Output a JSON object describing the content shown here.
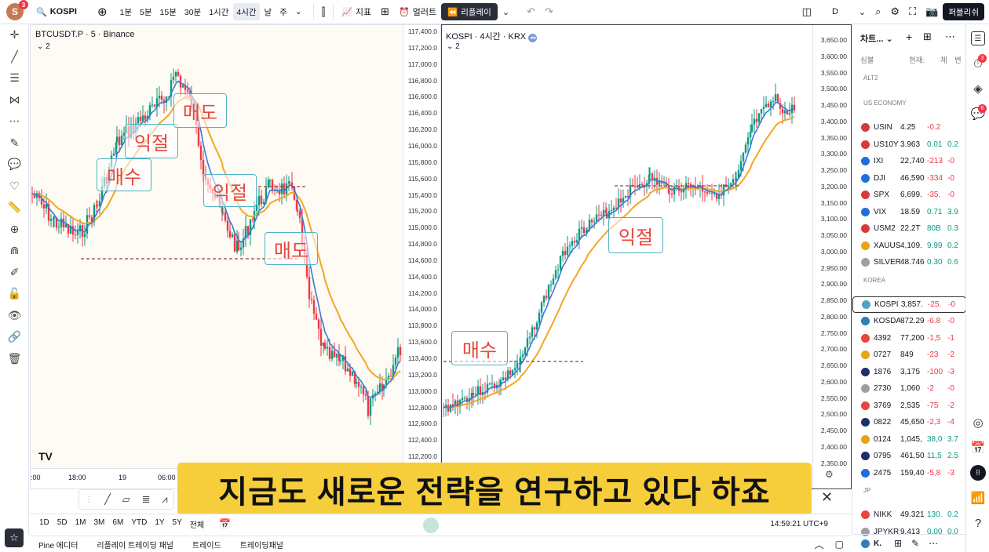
{
  "topbar": {
    "avatar_letter": "S",
    "avatar_badge": "3",
    "symbol": "KOSPI",
    "timeframes": [
      "1분",
      "5분",
      "15분",
      "30분",
      "1시간",
      "4시간",
      "날",
      "주"
    ],
    "active_timeframe": "4시간",
    "indicators_label": "지표",
    "alert_label": "얼러트",
    "replay_label": "리플레이",
    "layout_label": "D",
    "publish_label": "퍼블리쉬"
  },
  "chart_left": {
    "title": "BTCUSDT.P · 5 · Binance",
    "collapse_count": "2",
    "price_axis": [
      "117,400.0",
      "117,200.0",
      "117,000.0",
      "116,800.0",
      "116,600.0",
      "116,400.0",
      "116,200.0",
      "116,000.0",
      "115,800.0",
      "115,600.0",
      "115,400.0",
      "115,200.0",
      "115,000.0",
      "114,800.0",
      "114,600.0",
      "114,400.0",
      "114,200.0",
      "114,000.0",
      "113,800.0",
      "113,600.0",
      "113,400.0",
      "113,200.0",
      "113,000.0",
      "112,800.0",
      "112,600.0",
      "112,400.0",
      "112,200.0"
    ],
    "time_axis": [
      ":00",
      "18:00",
      "19",
      "06:00"
    ],
    "annotations": {
      "buy": "매수",
      "take1": "익절",
      "sell1": "매도",
      "take2": "익절",
      "sell2": "매도"
    },
    "logo": "TV"
  },
  "chart_right": {
    "title": "KOSPI · 4시간 · KRX",
    "collapse_count": "2",
    "price_axis": [
      "3,650.00",
      "3,600.00",
      "3,550.00",
      "3,500.00",
      "3,450.00",
      "3,400.00",
      "3,350.00",
      "3,300.00",
      "3,250.00",
      "3,200.00",
      "3,150.00",
      "3,100.00",
      "3,050.00",
      "3,000.00",
      "2,950.00",
      "2,900.00",
      "2,850.00",
      "2,800.00",
      "2,750.00",
      "2,700.00",
      "2,650.00",
      "2,600.00",
      "2,550.00",
      "2,500.00",
      "2,450.00",
      "2,400.00",
      "2,350.00"
    ],
    "annotations": {
      "buy": "매수",
      "take": "익절"
    }
  },
  "subtitle": "지금도 새로운 전략을 연구하고 있다 하죠",
  "bottombar": {
    "ranges": [
      "1D",
      "5D",
      "1M",
      "3M",
      "6M",
      "YTD",
      "1Y",
      "5Y",
      "전체"
    ],
    "clock": "14:59:21 UTC+9"
  },
  "paneltabs": [
    "Pine 에디터",
    "리플레이 트레이딩 패널",
    "트레이드",
    "트레이딩패널"
  ],
  "watchlist": {
    "title": "차트...",
    "columns": {
      "symbol": "심볼",
      "last": "현재:",
      "change": "체",
      "pct": "변"
    },
    "sections": [
      {
        "name": "ALT2",
        "rows": []
      },
      {
        "name": "US ECONOMY",
        "rows": [
          {
            "sym": "USIN",
            "last": "4.25",
            "chg": "-0.2",
            "pct": "",
            "dir": "down",
            "color": "#d63a3a"
          },
          {
            "sym": "US10Y",
            "last": "3.963",
            "chg": "0.01",
            "pct": "0.2",
            "dir": "up",
            "color": "#d63a3a"
          },
          {
            "sym": "IXI",
            "last": "22,740",
            "chg": "-213",
            "pct": "-0",
            "dir": "down",
            "color": "#1e6fd9"
          },
          {
            "sym": "DJI",
            "last": "46,590",
            "chg": "-334",
            "pct": "-0",
            "dir": "down",
            "color": "#1e6fd9"
          },
          {
            "sym": "SPX",
            "last": "6,699.",
            "chg": "-35.",
            "pct": "-0",
            "dir": "down",
            "color": "#d63a3a"
          },
          {
            "sym": "VIX",
            "last": "18.59",
            "chg": "0.71",
            "pct": "3.9",
            "dir": "up",
            "color": "#1e6fd9"
          },
          {
            "sym": "USM2",
            "last": "22.2T",
            "chg": "80B",
            "pct": "0.3",
            "dir": "up",
            "color": "#d63a3a"
          },
          {
            "sym": "XAUUS",
            "last": "4,109.",
            "chg": "9.99",
            "pct": "0.2",
            "dir": "up",
            "color": "#e7a318"
          },
          {
            "sym": "SILVER",
            "last": "48.746",
            "chg": "0.30",
            "pct": "0.6",
            "dir": "up",
            "color": "#9aa0a6"
          }
        ]
      },
      {
        "name": "KOREA",
        "rows": [
          {
            "sym": "KOSPI",
            "last": "3,857.",
            "chg": "-25.",
            "pct": "-0",
            "dir": "down",
            "color": "#4fa3c7"
          },
          {
            "sym": "KOSDA",
            "last": "872.29",
            "chg": "-6.8",
            "pct": "-0",
            "dir": "down",
            "color": "#2f7fb8"
          },
          {
            "sym": "4392",
            "last": "77,200",
            "chg": "-1,5",
            "pct": "-1",
            "dir": "down",
            "color": "#e4473d"
          },
          {
            "sym": "0727",
            "last": "849",
            "chg": "-23",
            "pct": "-2",
            "dir": "down",
            "color": "#e7a318"
          },
          {
            "sym": "1876",
            "last": "3,175",
            "chg": "-100",
            "pct": "-3",
            "dir": "down",
            "color": "#1a2f6e"
          },
          {
            "sym": "2730",
            "last": "1,060",
            "chg": "-2",
            "pct": "-0",
            "dir": "down",
            "color": "#9aa0a6"
          },
          {
            "sym": "3769",
            "last": "2,535",
            "chg": "-75",
            "pct": "-2",
            "dir": "down",
            "color": "#e4473d"
          },
          {
            "sym": "0822",
            "last": "45,650",
            "chg": "-2,3",
            "pct": "-4",
            "dir": "down",
            "color": "#1a2f6e"
          },
          {
            "sym": "0124",
            "last": "1,045,",
            "chg": "38,0",
            "pct": "3.7",
            "dir": "up",
            "color": "#e7a318"
          },
          {
            "sym": "0795",
            "last": "461,50",
            "chg": "11,5",
            "pct": "2.5",
            "dir": "up",
            "color": "#1a2f6e"
          },
          {
            "sym": "2475",
            "last": "159,40",
            "chg": "-5,8",
            "pct": "-3",
            "dir": "down",
            "color": "#1e6fd9"
          }
        ]
      },
      {
        "name": "JP",
        "rows": [
          {
            "sym": "NIKK",
            "last": "49.321",
            "chg": "130.",
            "pct": "0.2",
            "dir": "up",
            "color": "#e4473d"
          },
          {
            "sym": "JPYKR",
            "last": "9.413",
            "chg": "0.00",
            "pct": "0.0",
            "dir": "up",
            "color": "#9aa0a6"
          }
        ]
      }
    ],
    "footer_symbol": "K."
  },
  "right_badges": {
    "alerts": "3",
    "chat": "6"
  },
  "colors": {
    "up": "#089981",
    "down": "#f23645",
    "ema_fast": "#3a78d6",
    "ema_slow": "#f5a623",
    "label_border": "#4fb3c2",
    "label_text": "#e4473d",
    "subtitle_bg": "#f6cd3b"
  }
}
